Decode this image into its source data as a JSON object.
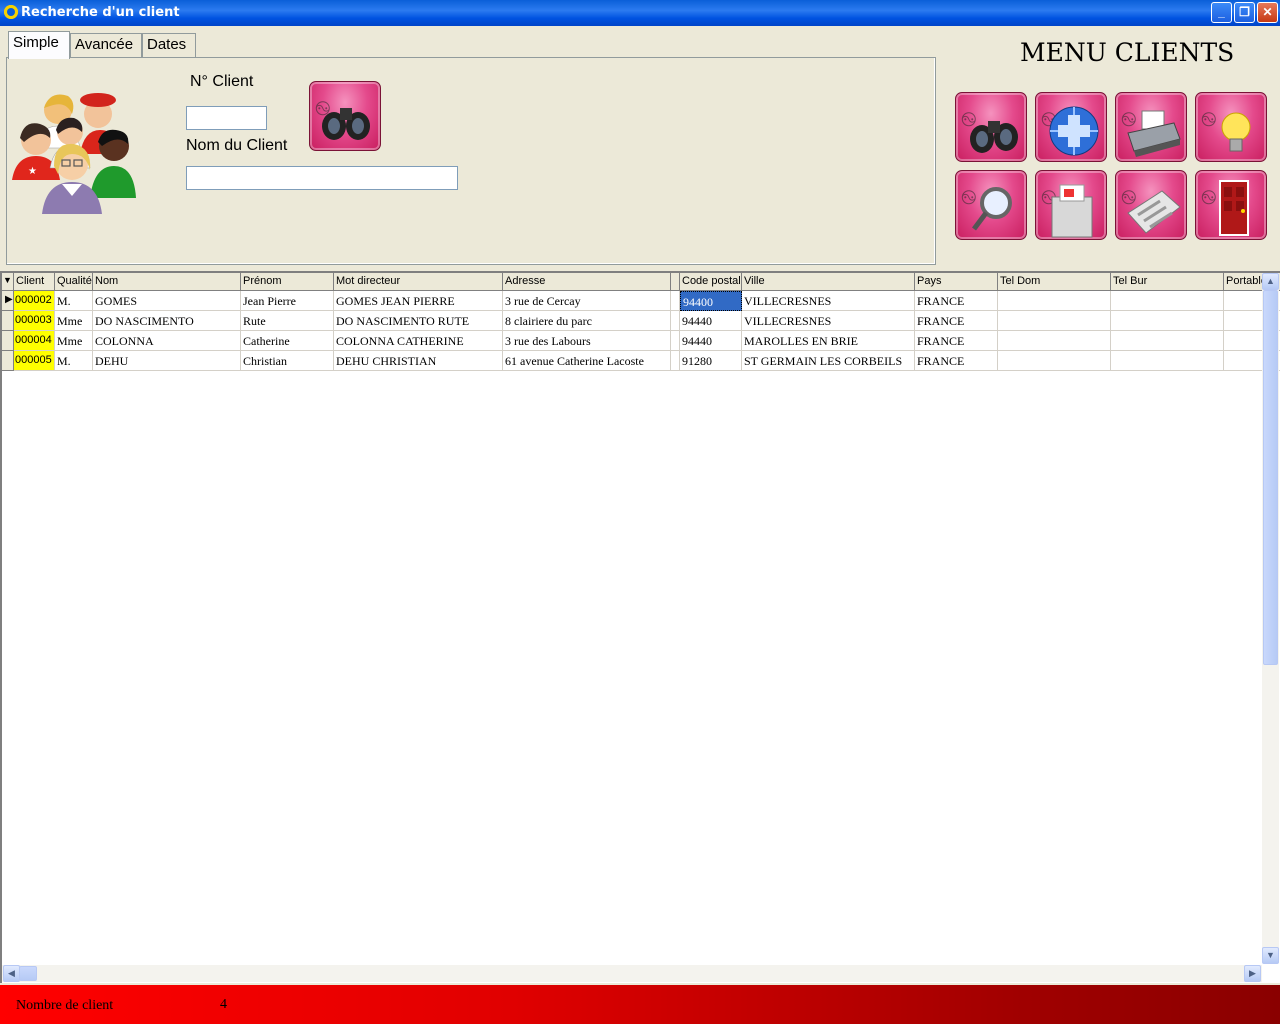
{
  "window": {
    "title": "Recherche d'un client"
  },
  "tabs": [
    {
      "label": "Simple"
    },
    {
      "label": "Avancée"
    },
    {
      "label": "Dates"
    }
  ],
  "search": {
    "client_no_label": "N° Client",
    "client_no_value": "",
    "client_name_label": "Nom du Client",
    "client_name_value": ""
  },
  "menu": {
    "title": "MENU CLIENTS",
    "buttons": [
      "binoculars-icon",
      "globe-plus-icon",
      "printer-icon",
      "lightbulb-icon",
      "magnifier-icon",
      "shredder-icon",
      "calculator-icon",
      "exit-door-icon"
    ]
  },
  "grid": {
    "columns": [
      "Client",
      "Qualité",
      "Nom",
      "Prénom",
      "Mot directeur",
      "Adresse",
      "",
      "Code postal",
      "Ville",
      "Pays",
      "Tel Dom",
      "Tel Bur",
      "Portable"
    ],
    "rows": [
      [
        "000002",
        "M.",
        "GOMES",
        "Jean Pierre",
        "GOMES JEAN PIERRE",
        "3 rue de Cercay",
        "",
        "94400",
        "VILLECRESNES",
        "FRANCE",
        "",
        "",
        ""
      ],
      [
        "000003",
        "Mme",
        "DO NASCIMENTO",
        "Rute",
        "DO NASCIMENTO RUTE",
        "8 clairiere du parc",
        "",
        "94440",
        "VILLECRESNES",
        "FRANCE",
        "",
        "",
        ""
      ],
      [
        "000004",
        "Mme",
        "COLONNA",
        "Catherine",
        "COLONNA CATHERINE",
        "3 rue des Labours",
        "",
        "94440",
        "MAROLLES EN BRIE",
        "FRANCE",
        "",
        "",
        ""
      ],
      [
        "000005",
        "M.",
        "DEHU",
        "Christian",
        "DEHU CHRISTIAN",
        "61 avenue Catherine Lacoste",
        "",
        "91280",
        "ST GERMAIN LES CORBEILS",
        "FRANCE",
        "",
        "",
        ""
      ]
    ],
    "selected_row": 0,
    "selected_column": "Code postal"
  },
  "status": {
    "label": "Nombre de client",
    "count": "4"
  },
  "colors": {
    "titlebar": "#0A5FD8",
    "id_highlight": "#FFFF00",
    "status_bar": "#E00000",
    "button_pink": "#E44A8C"
  }
}
